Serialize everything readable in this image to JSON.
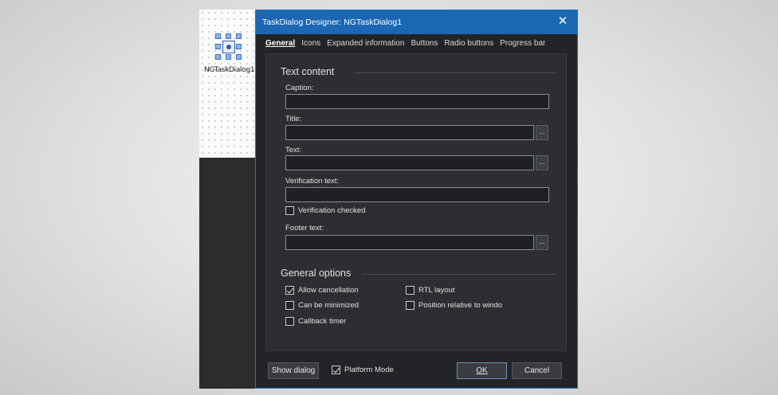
{
  "designer": {
    "component_label": "NGTaskDialog1"
  },
  "dialog": {
    "title": "TaskDialog Designer: NGTaskDialog1",
    "close": "✕"
  },
  "tabs": [
    {
      "label": "General",
      "active": true
    },
    {
      "label": "Icons"
    },
    {
      "label": "Expanded information"
    },
    {
      "label": "Buttons"
    },
    {
      "label": "Radio buttons"
    },
    {
      "label": "Progress bar"
    }
  ],
  "text_content": {
    "heading": "Text content",
    "caption_label": "Caption:",
    "caption_value": "",
    "title_label": "Title:",
    "title_value": "",
    "text_label": "Text:",
    "text_value": "",
    "verification_label": "Verification text:",
    "verification_value": "",
    "verification_checked_label": "Verification checked",
    "verification_checked": false,
    "footer_label": "Footer text:",
    "footer_value": "",
    "ellipsis": "..."
  },
  "general_options": {
    "heading": "General options",
    "allow_cancellation": {
      "label": "Allow cancellation",
      "checked": true
    },
    "can_be_minimized": {
      "label": "Can be minimized",
      "checked": false
    },
    "callback_timer": {
      "label": "Callback timer",
      "checked": false
    },
    "rtl_layout": {
      "label": "RTL layout",
      "checked": false
    },
    "position_relative": {
      "label": "Position relative to windo",
      "checked": false
    }
  },
  "footer": {
    "show_dialog": "Show dialog",
    "platform_mode": {
      "label": "Platform Mode",
      "checked": true
    },
    "ok": "OK",
    "cancel": "Cancel"
  },
  "colors": {
    "titlebar": "#1b67b3",
    "dialog_bg": "#232427",
    "panel_bg": "#2d2e31",
    "accent_border": "#1c74c9"
  },
  "icons": {
    "component": "task-dialog-component-icon",
    "close": "close-icon",
    "ellipsis": "ellipsis-icon",
    "checkbox": "checkbox-icon"
  }
}
